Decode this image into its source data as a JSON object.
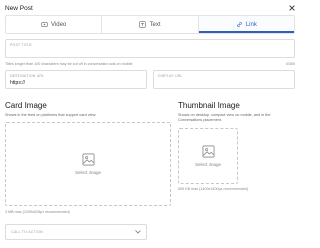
{
  "modal": {
    "title": "New Post"
  },
  "tabs": [
    {
      "label": "Video",
      "icon": "video-icon",
      "active": false
    },
    {
      "label": "Text",
      "icon": "text-icon",
      "active": false
    },
    {
      "label": "Link",
      "icon": "link-icon",
      "active": true
    }
  ],
  "post_title": {
    "label": "POST TITLE",
    "value": "",
    "hint": "Titles longer than 100 characters may be cut off in conversation ads on mobile",
    "counter": "0/300"
  },
  "destination_url": {
    "label": "DESTINATION URL",
    "value": "https://"
  },
  "display_url": {
    "label": "DISPLAY URL",
    "value": ""
  },
  "card_image": {
    "title": "Card Image",
    "description": "Shows in the feed on platforms that support card view.",
    "upload_label": "Select image",
    "size_note": "3 MB max (1200x628px recommended)"
  },
  "thumbnail_image": {
    "title": "Thumbnail Image",
    "description": "Shows on desktop, compact view on mobile, and in the Conversations placement.",
    "upload_label": "Select image",
    "size_note": "500 KB max (1400x1400px recommended)"
  },
  "call_to_action": {
    "label": "CALL TO ACTION"
  },
  "colors": {
    "accent": "#2e5fbd",
    "border": "#dcdcdc"
  }
}
